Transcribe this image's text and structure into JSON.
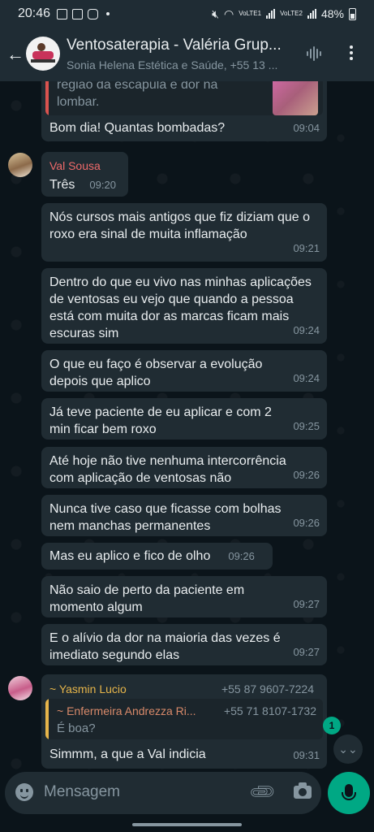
{
  "status_bar": {
    "time": "20:46",
    "battery": "48%",
    "sim1": "VoLTE1",
    "sim2": "VoLTE2"
  },
  "header": {
    "title": "Ventosaterapia - Valéria Grup...",
    "subtitle": "Sonia Helena Estética e Saúde, +55 13 ..."
  },
  "messages": [
    {
      "quote": "região da escápula e dor na\nlombar.",
      "text": "Bom dia! Quantas bombadas?",
      "time": "09:04"
    },
    {
      "sender": "Val Sousa",
      "text": "Três",
      "time": "09:20"
    },
    {
      "text": "Nós cursos mais antigos que fiz diziam que o roxo era sinal de muita inflamação",
      "time": "09:21"
    },
    {
      "text": "Dentro do que eu vivo nas minhas aplicações de ventosas eu vejo que quando a pessoa está com muita dor as marcas ficam mais escuras sim",
      "time": "09:24"
    },
    {
      "text": "O que eu faço é observar a evolução depois que aplico",
      "time": "09:24"
    },
    {
      "text": "Já teve paciente de eu aplicar e com 2 min ficar bem roxo",
      "time": "09:25"
    },
    {
      "text": "Até hoje não tive nenhuma intercorrência com aplicação de ventosas não",
      "time": "09:26"
    },
    {
      "text": "Nunca tive caso que ficasse com bolhas nem manchas permanentes",
      "time": "09:26"
    },
    {
      "text": "Mas eu aplico e fico de olho",
      "time": "09:26"
    },
    {
      "text": "Não saio de perto da paciente em momento algum",
      "time": "09:27"
    },
    {
      "text": "E o alívio da dor na maioria das vezes é imediato segundo elas",
      "time": "09:27"
    },
    {
      "sender": "~ Yasmin Lucio",
      "sender_phone": "+55 87 9607-7224",
      "quote_author": "~ Enfermeira Andrezza Ri...",
      "quote_phone": "+55 71 8107-1732",
      "quote": "É boa?",
      "text": "Simmm, a que a Val indicia",
      "time": "09:31"
    }
  ],
  "unread_count": "1",
  "composer": {
    "placeholder": "Mensagem"
  },
  "colors": {
    "accent": "#00a884",
    "bubble": "#202c33",
    "val_name": "#ef6a6a",
    "yasmin_name": "#e6b54a"
  }
}
